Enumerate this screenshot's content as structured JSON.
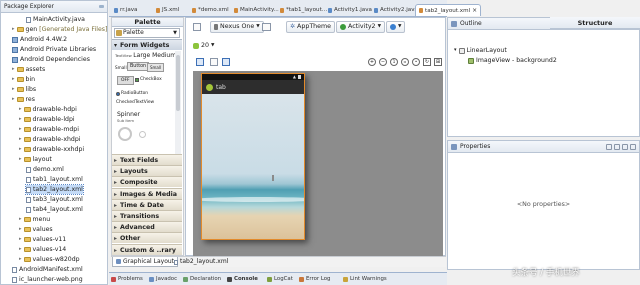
{
  "package_explorer": {
    "title": "Package Explorer",
    "items": [
      {
        "label": "MainActivity.java",
        "kind": "file",
        "indent": 3
      },
      {
        "label": "gen",
        "suffix": "[Generated Java Files]",
        "kind": "folder",
        "indent": 1
      },
      {
        "label": "Android 4.4W.2",
        "kind": "pkg",
        "indent": 1
      },
      {
        "label": "Android Private Libraries",
        "kind": "pkg",
        "indent": 1
      },
      {
        "label": "Android Dependencies",
        "kind": "pkg",
        "indent": 1
      },
      {
        "label": "assets",
        "kind": "folder",
        "indent": 1
      },
      {
        "label": "bin",
        "kind": "folder",
        "indent": 1
      },
      {
        "label": "libs",
        "kind": "folder",
        "indent": 1
      },
      {
        "label": "res",
        "kind": "folder",
        "indent": 1
      },
      {
        "label": "drawable-hdpi",
        "kind": "folder",
        "indent": 2
      },
      {
        "label": "drawable-ldpi",
        "kind": "folder",
        "indent": 2
      },
      {
        "label": "drawable-mdpi",
        "kind": "folder",
        "indent": 2
      },
      {
        "label": "drawable-xhdpi",
        "kind": "folder",
        "indent": 2
      },
      {
        "label": "drawable-xxhdpi",
        "kind": "folder",
        "indent": 2
      },
      {
        "label": "layout",
        "kind": "folder",
        "indent": 2
      },
      {
        "label": "demo.xml",
        "kind": "file",
        "indent": 3
      },
      {
        "label": "tab1_layout.xml",
        "kind": "file",
        "indent": 3
      },
      {
        "label": "tab2_layout.xml",
        "kind": "file",
        "indent": 3,
        "selected": true
      },
      {
        "label": "tab3_layout.xml",
        "kind": "file",
        "indent": 3
      },
      {
        "label": "tab4_layout.xml",
        "kind": "file",
        "indent": 3
      },
      {
        "label": "menu",
        "kind": "folder",
        "indent": 2
      },
      {
        "label": "values",
        "kind": "folder",
        "indent": 2
      },
      {
        "label": "values-v11",
        "kind": "folder",
        "indent": 2
      },
      {
        "label": "values-v14",
        "kind": "folder",
        "indent": 2
      },
      {
        "label": "values-w820dp",
        "kind": "folder",
        "indent": 2
      },
      {
        "label": "AndroidManifest.xml",
        "kind": "file",
        "indent": 1
      },
      {
        "label": "ic_launcher-web.png",
        "kind": "file",
        "indent": 1
      }
    ]
  },
  "editor_tabs": [
    {
      "label": "rr.java"
    },
    {
      "label": "JS.xml"
    },
    {
      "label": "*demo.xml"
    },
    {
      "label": "MainActivity..."
    },
    {
      "label": "*tab1_layout..."
    },
    {
      "label": "Activity1.java"
    },
    {
      "label": "Activity2.java"
    },
    {
      "label": "tab2_layout.xml",
      "active": true
    }
  ],
  "palette": {
    "title": "Palette",
    "dropdown": "Palette",
    "form_widgets_header": "Form Widgets",
    "textview_large": "TextView",
    "large_medium": "Large Medium",
    "small_label": "Small",
    "button_label": "Button",
    "small_btn": "Small",
    "off_label": "OFF",
    "checkbox_label": "CheckBox",
    "radio_label": "RadioButton",
    "checked_tv": "CheckedTextView",
    "spinner_label": "Spinner",
    "spinner_sub": "Sub Item",
    "categories": [
      "Text Fields",
      "Layouts",
      "Composite",
      "Images & Media",
      "Time & Date",
      "Transitions",
      "Advanced",
      "Other",
      "Custom & ..rary Views"
    ]
  },
  "toolbar": {
    "device": "Nexus One",
    "theme": "AppTheme",
    "activity": "Activity2",
    "api": "20"
  },
  "device_preview": {
    "app_title": "tab"
  },
  "bottom_editor_tabs": {
    "graphical": "Graphical Layout",
    "xml": "tab2_layout.xml"
  },
  "outline": {
    "title": "Outline",
    "structure": "Structure",
    "root": "LinearLayout",
    "child": "ImageView - background2"
  },
  "properties": {
    "title": "Properties",
    "empty": "<No properties>"
  },
  "bottom_views": [
    "Problems",
    "Javadoc",
    "Declaration",
    "Console",
    "LogCat",
    "Error Log",
    "Lint Warnings"
  ],
  "watermark": "头条号 / 手机世界"
}
